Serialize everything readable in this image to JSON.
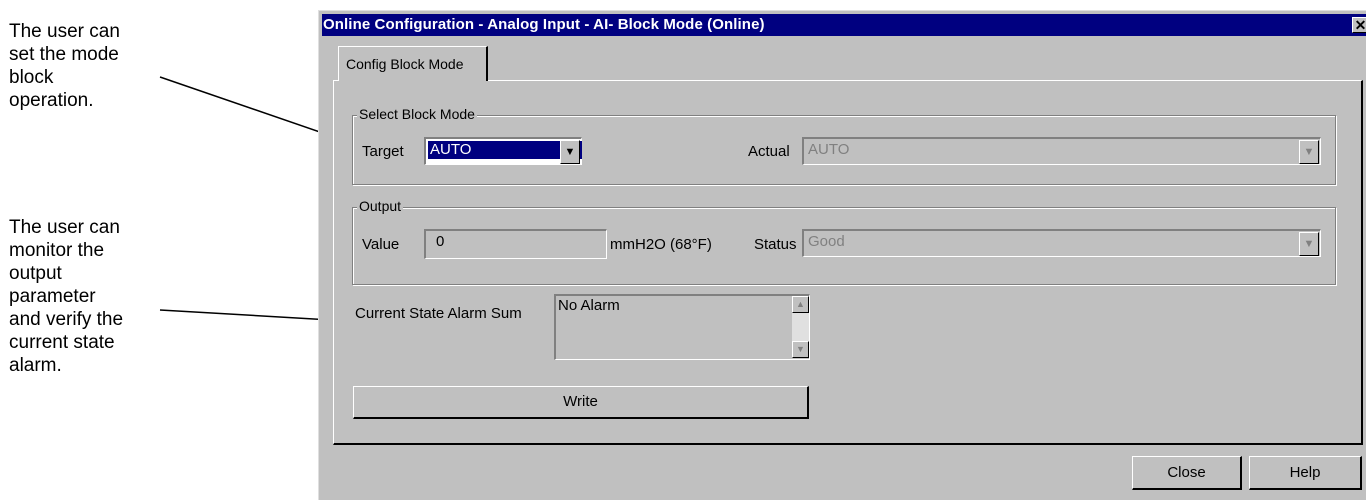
{
  "annotations": {
    "block_mode": "The user can\nset the mode\nblock\noperation.",
    "output": "The user can\nmonitor the\noutput\nparameter\nand verify the\ncurrent state\nalarm."
  },
  "window": {
    "title": "Online Configuration - Analog Input - AI- Block Mode  (Online)",
    "close_glyph": "✕"
  },
  "tabs": [
    {
      "label": "Config Block Mode",
      "selected": true
    }
  ],
  "select_block_mode": {
    "legend": "Select Block Mode",
    "target_label": "Target",
    "target_value": "AUTO",
    "actual_label": "Actual",
    "actual_value": "AUTO"
  },
  "output": {
    "legend": "Output",
    "value_label": "Value",
    "value": "0",
    "unit": "mmH2O (68°F)",
    "status_label": "Status",
    "status_value": "Good"
  },
  "alarm": {
    "label": "Current State Alarm Sum",
    "value": "No Alarm"
  },
  "buttons": {
    "write": "Write",
    "close": "Close",
    "help": "Help"
  },
  "icons": {
    "dropdown": "chevron-down-icon",
    "scroll_up": "arrow-up-icon",
    "scroll_down": "arrow-down-icon"
  }
}
